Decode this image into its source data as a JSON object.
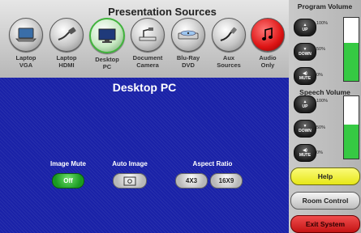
{
  "sources": {
    "title": "Presentation Sources",
    "items": [
      {
        "name": "laptop-vga",
        "label_1": "Laptop",
        "label_2": "VGA",
        "icon": "laptop-icon"
      },
      {
        "name": "laptop-hdmi",
        "label_1": "Laptop",
        "label_2": "HDMI",
        "icon": "hdmi-cable-icon"
      },
      {
        "name": "desktop-pc",
        "label_1": "Desktop",
        "label_2": "PC",
        "icon": "desktop-monitor-icon"
      },
      {
        "name": "document-camera",
        "label_1": "Document",
        "label_2": "Camera",
        "icon": "document-camera-icon"
      },
      {
        "name": "blu-ray-dvd",
        "label_1": "Blu-Ray",
        "label_2": "DVD",
        "icon": "disc-player-icon"
      },
      {
        "name": "aux-sources",
        "label_1": "Aux",
        "label_2": "Sources",
        "icon": "aux-cable-icon"
      },
      {
        "name": "audio-only",
        "label_1": "Audio",
        "label_2": "Only",
        "icon": "music-note-icon"
      }
    ]
  },
  "main": {
    "title": "Desktop PC",
    "image_mute": {
      "label": "Image Mute",
      "value": "Off"
    },
    "auto_image": {
      "label": "Auto Image"
    },
    "aspect_ratio": {
      "label": "Aspect Ratio",
      "option_1": "4X3",
      "option_2": "16X9"
    }
  },
  "program_volume": {
    "title": "Program Volume",
    "up": "UP",
    "down": "DOWN",
    "mute": "MUTE",
    "tick_100": "100%",
    "tick_50": "50%",
    "tick_0": "0%",
    "level": 0.6
  },
  "speech_volume": {
    "title": "Speech Volume",
    "up": "UP",
    "down": "DOWN",
    "mute": "MUTE",
    "tick_100": "100%",
    "tick_50": "50%",
    "tick_0": "0%",
    "level": 0.55
  },
  "actions": {
    "help": "Help",
    "room_control": "Room Control",
    "exit_system": "Exit System"
  },
  "colors": {
    "main_blue": "#1a22a8",
    "active_green": "#41b33d",
    "help_yellow": "#f2f23a",
    "exit_red": "#d61b1b",
    "meter_green": "#36c943"
  }
}
